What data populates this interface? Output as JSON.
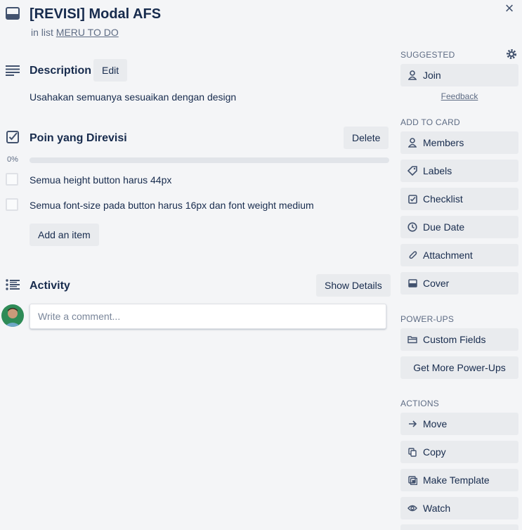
{
  "card": {
    "title": "[REVISI] Modal AFS",
    "in_list_prefix": "in list",
    "list_name": "MERU TO DO"
  },
  "description": {
    "heading": "Description",
    "edit_label": "Edit",
    "text": "Usahakan semuanya sesuaikan dengan design"
  },
  "checklist": {
    "heading": "Poin yang Direvisi",
    "delete_label": "Delete",
    "progress_label": "0%",
    "progress_fraction": 0,
    "items": [
      {
        "text": "Semua height button harus 44px",
        "checked": false
      },
      {
        "text": "Semua font-size pada button harus 16px dan font weight medium",
        "checked": false
      }
    ],
    "add_item_label": "Add an item"
  },
  "activity": {
    "heading": "Activity",
    "show_details_label": "Show Details",
    "comment_placeholder": "Write a comment..."
  },
  "sidebar": {
    "suggested": {
      "heading": "SUGGESTED",
      "join_label": "Join",
      "feedback_label": "Feedback"
    },
    "add_to_card": {
      "heading": "ADD TO CARD",
      "items": [
        "Members",
        "Labels",
        "Checklist",
        "Due Date",
        "Attachment",
        "Cover"
      ]
    },
    "power_ups": {
      "heading": "POWER-UPS",
      "custom_fields_label": "Custom Fields",
      "get_more_label": "Get More Power-Ups"
    },
    "actions": {
      "heading": "ACTIONS",
      "items": [
        "Move",
        "Copy",
        "Make Template",
        "Watch"
      ]
    }
  },
  "colors": {
    "background": "#f4f5f7",
    "text": "#172b4d",
    "muted": "#5e6c84",
    "button": "#e9ebee"
  }
}
